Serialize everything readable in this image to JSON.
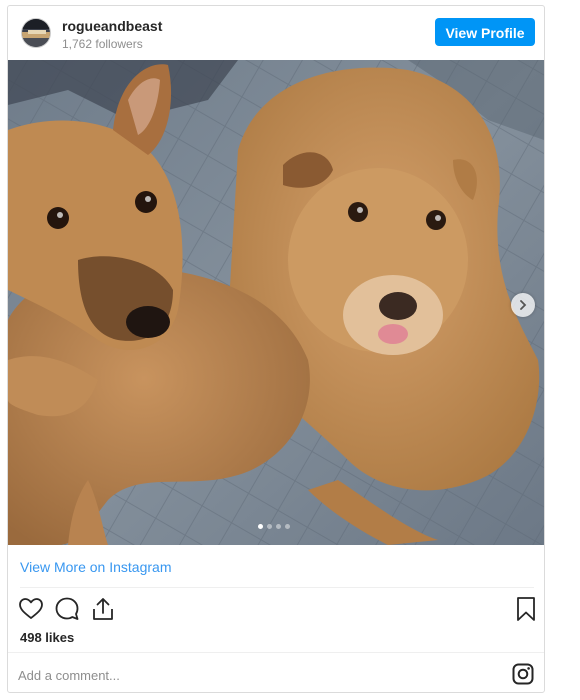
{
  "header": {
    "username": "rogueandbeast",
    "followers": "1,762 followers",
    "view_profile_label": "View Profile"
  },
  "post": {
    "image_alt": "Two tan terrier-mix dogs lying on a grey quilted blanket",
    "carousel_slides": 4,
    "carousel_active": 1
  },
  "footer": {
    "view_more_label": "View More on Instagram",
    "likes": "498 likes",
    "comment_placeholder": "Add a comment..."
  },
  "icons": {
    "like": "heart-icon",
    "comment": "comment-icon",
    "share": "share-icon",
    "save": "bookmark-icon",
    "brand": "instagram-icon",
    "next": "chevron-right-icon"
  },
  "colors": {
    "accent": "#0095f6",
    "link": "#3897f0",
    "text": "#262626",
    "muted": "#8e8e8e"
  }
}
